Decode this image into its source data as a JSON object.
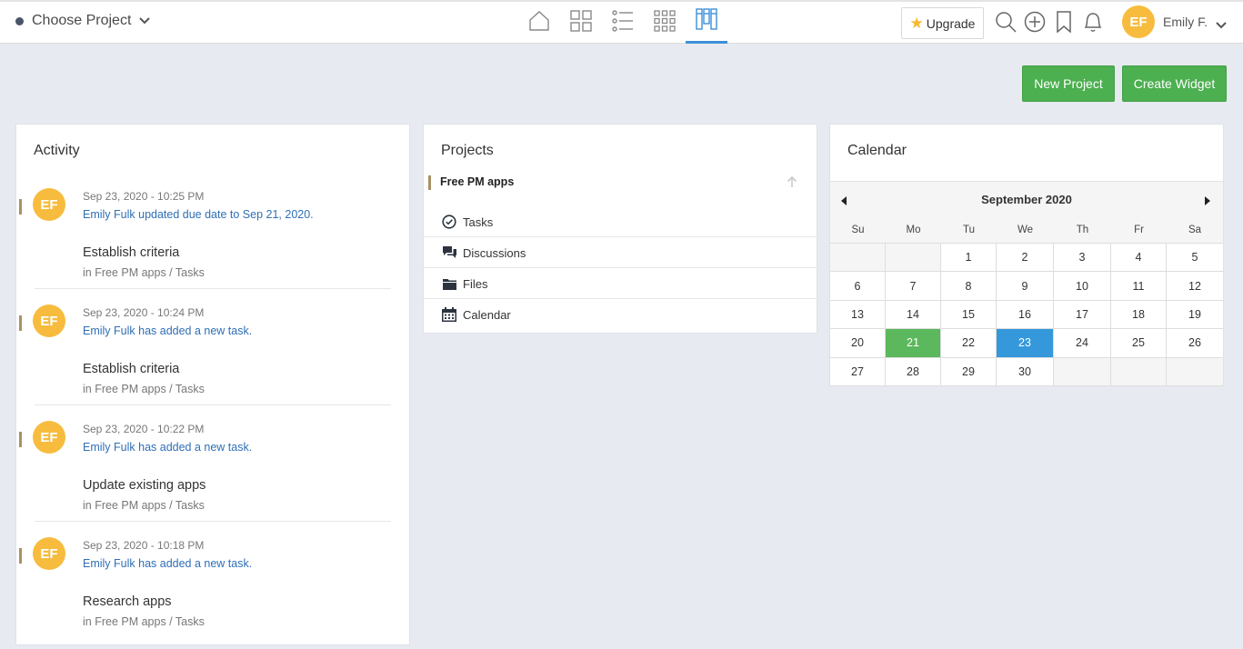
{
  "topbar": {
    "project_chooser": "Choose Project",
    "upgrade_label": "Upgrade",
    "avatar_initials": "EF",
    "user_name": "Emily F.",
    "accent_color": "#3d8fd8"
  },
  "actions": {
    "new_project": "New Project",
    "create_widget": "Create Widget",
    "button_color": "#4caf50"
  },
  "activity": {
    "title": "Activity",
    "items": [
      {
        "initials": "EF",
        "time": "Sep 23, 2020 - 10:25 PM",
        "text": "Emily Fulk updated due date to Sep 21, 2020.",
        "task": "Establish criteria",
        "location": "in Free PM apps / Tasks"
      },
      {
        "initials": "EF",
        "time": "Sep 23, 2020 - 10:24 PM",
        "text": "Emily Fulk has added a new task.",
        "task": "Establish criteria",
        "location": "in Free PM apps / Tasks"
      },
      {
        "initials": "EF",
        "time": "Sep 23, 2020 - 10:22 PM",
        "text": "Emily Fulk has added a new task.",
        "task": "Update existing apps",
        "location": "in Free PM apps / Tasks"
      },
      {
        "initials": "EF",
        "time": "Sep 23, 2020 - 10:18 PM",
        "text": "Emily Fulk has added a new task.",
        "task": "Research apps",
        "location": "in Free PM apps / Tasks"
      }
    ]
  },
  "projects": {
    "title": "Projects",
    "project_name": "Free PM apps",
    "links": [
      {
        "label": "Tasks",
        "icon": "check-circle-icon"
      },
      {
        "label": "Discussions",
        "icon": "chat-bubbles-icon"
      },
      {
        "label": "Files",
        "icon": "folder-icon"
      },
      {
        "label": "Calendar",
        "icon": "calendar-icon"
      }
    ]
  },
  "calendar": {
    "title": "Calendar",
    "month": "September 2020",
    "weekdays": [
      "Su",
      "Mo",
      "Tu",
      "We",
      "Th",
      "Fr",
      "Sa"
    ],
    "weeks": [
      [
        "",
        "",
        "1",
        "2",
        "3",
        "4",
        "5"
      ],
      [
        "6",
        "7",
        "8",
        "9",
        "10",
        "11",
        "12"
      ],
      [
        "13",
        "14",
        "15",
        "16",
        "17",
        "18",
        "19"
      ],
      [
        "20",
        "21",
        "22",
        "23",
        "24",
        "25",
        "26"
      ],
      [
        "27",
        "28",
        "29",
        "30",
        "",
        "",
        ""
      ]
    ],
    "due_date_highlight": "21",
    "today_highlight": "23",
    "due_color": "#5cb85c",
    "today_color": "#3498db"
  }
}
